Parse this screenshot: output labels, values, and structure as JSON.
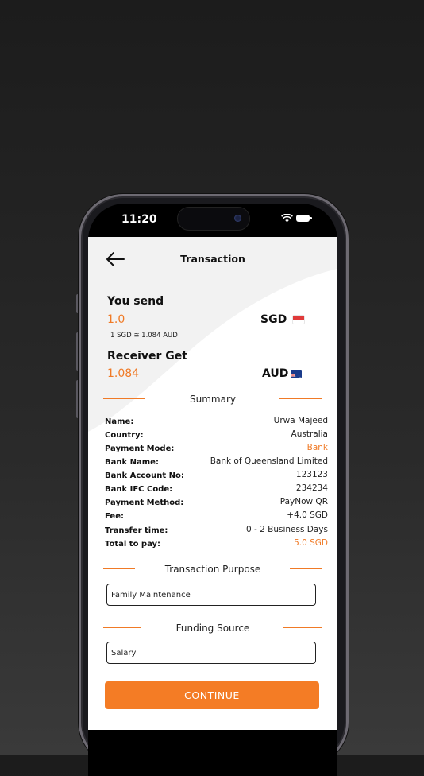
{
  "status_bar": {
    "time": "11:20"
  },
  "header": {
    "title": "Transaction"
  },
  "send": {
    "title": "You send",
    "amount": "1.0",
    "currency": "SGD",
    "rate": "1 SGD  ≅ 1.084 AUD"
  },
  "receive": {
    "title": "Receiver Get",
    "amount": "1.084",
    "currency": "AUD"
  },
  "summary": {
    "title": "Summary",
    "rows": [
      {
        "label": "Name:",
        "value": "Urwa Majeed"
      },
      {
        "label": "Country:",
        "value": "Australia"
      },
      {
        "label": "Payment Mode:",
        "value": "Bank"
      },
      {
        "label": "Bank Name:",
        "value": "Bank of Queensland Limited"
      },
      {
        "label": "Bank Account No:",
        "value": "123123"
      },
      {
        "label": "Bank IFC Code:",
        "value": "234234"
      },
      {
        "label": "Payment Method:",
        "value": "PayNow QR"
      },
      {
        "label": "Fee:",
        "value": "+4.0 SGD"
      },
      {
        "label": "Transfer time:",
        "value": "0 - 2 Business Days"
      },
      {
        "label": "Total to pay:",
        "value": "5.0 SGD"
      }
    ]
  },
  "purpose": {
    "title": "Transaction Purpose",
    "value": "Family Maintenance"
  },
  "funding": {
    "title": "Funding Source",
    "value": "Salary"
  },
  "continue_label": "CONTINUE",
  "colors": {
    "accent": "#f47c25",
    "background": "#ffffff",
    "curve": "#f2f2f2"
  },
  "icons": {
    "back": "arrow-left-icon",
    "wifi": "wifi-icon",
    "battery": "battery-icon",
    "flag_send": "singapore-flag-icon",
    "flag_receive": "australia-flag-icon"
  }
}
